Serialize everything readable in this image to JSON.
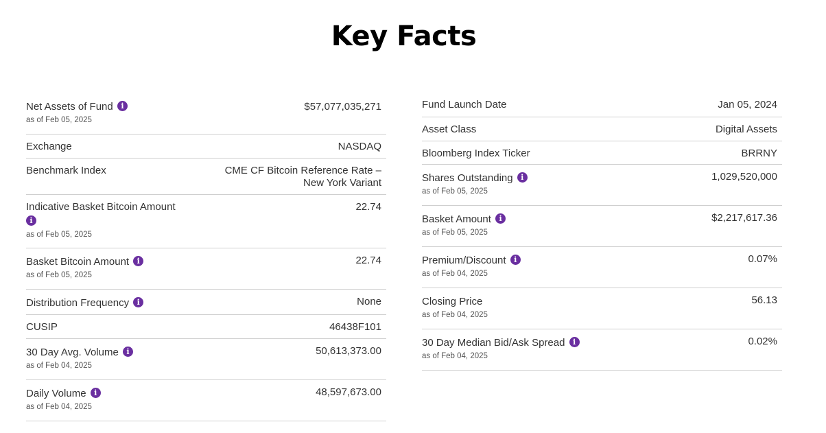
{
  "page_title": "Key Facts",
  "left": [
    {
      "label": "Net Assets of Fund",
      "info": true,
      "as_of": "as of Feb 05, 2025",
      "value": "$57,077,035,271"
    },
    {
      "label": "Exchange",
      "info": false,
      "as_of": "",
      "value": "NASDAQ"
    },
    {
      "label": "Benchmark Index",
      "info": false,
      "as_of": "",
      "value": "CME CF Bitcoin Reference Rate – New York Variant"
    },
    {
      "label": "Indicative Basket Bitcoin Amount",
      "info": true,
      "as_of": "as of Feb 05, 2025",
      "value": "22.74"
    },
    {
      "label": "Basket Bitcoin Amount",
      "info": true,
      "as_of": "as of Feb 05, 2025",
      "value": "22.74"
    },
    {
      "label": "Distribution Frequency",
      "info": true,
      "as_of": "",
      "value": "None"
    },
    {
      "label": "CUSIP",
      "info": false,
      "as_of": "",
      "value": "46438F101"
    },
    {
      "label": "30 Day Avg. Volume",
      "info": true,
      "as_of": "as of Feb 04, 2025",
      "value": "50,613,373.00"
    },
    {
      "label": "Daily Volume",
      "info": true,
      "as_of": "as of Feb 04, 2025",
      "value": "48,597,673.00"
    }
  ],
  "right": [
    {
      "label": "Fund Launch Date",
      "info": false,
      "as_of": "",
      "value": "Jan 05, 2024"
    },
    {
      "label": "Asset Class",
      "info": false,
      "as_of": "",
      "value": "Digital Assets"
    },
    {
      "label": "Bloomberg Index Ticker",
      "info": false,
      "as_of": "",
      "value": "BRRNY"
    },
    {
      "label": "Shares Outstanding",
      "info": true,
      "as_of": "as of Feb 05, 2025",
      "value": "1,029,520,000"
    },
    {
      "label": "Basket Amount",
      "info": true,
      "as_of": "as of Feb 05, 2025",
      "value": "$2,217,617.36"
    },
    {
      "label": "Premium/Discount",
      "info": true,
      "as_of": "as of Feb 04, 2025",
      "value": "0.07%"
    },
    {
      "label": "Closing Price",
      "info": false,
      "as_of": "as of Feb 04, 2025",
      "value": "56.13"
    },
    {
      "label": "30 Day Median Bid/Ask Spread",
      "info": true,
      "as_of": "as of Feb 04, 2025",
      "value": "0.02%"
    }
  ],
  "icons": {
    "info": "info-icon"
  },
  "colors": {
    "info_icon": "#6a2fa0",
    "divider": "#cfcfcf"
  }
}
